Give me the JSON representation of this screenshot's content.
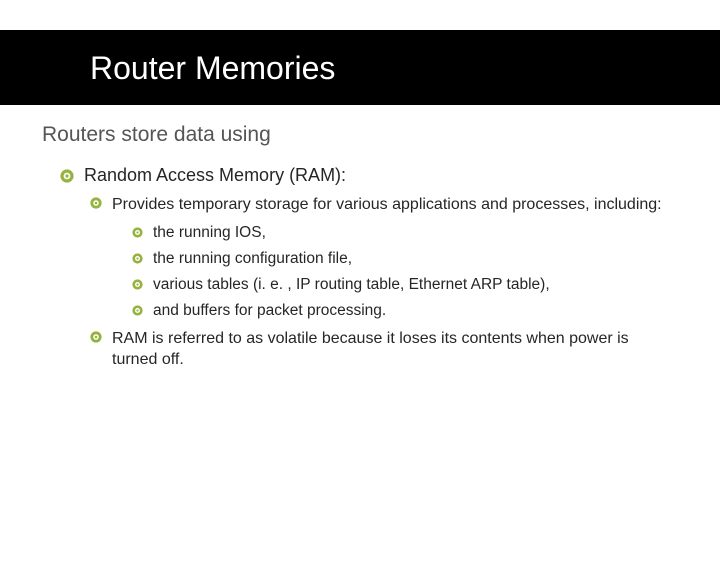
{
  "title": "Router Memories",
  "subtitle": "Routers store data using",
  "section_heading": "Random Access Memory (RAM):",
  "intro": "Provides temporary storage for various applications and processes, including:",
  "items": [
    "the running IOS,",
    "the running configuration file,",
    "various tables (i. e. , IP routing table, Ethernet ARP table),",
    "and buffers for packet processing."
  ],
  "footnote": "RAM is referred to as volatile because it loses its contents when power is turned off."
}
